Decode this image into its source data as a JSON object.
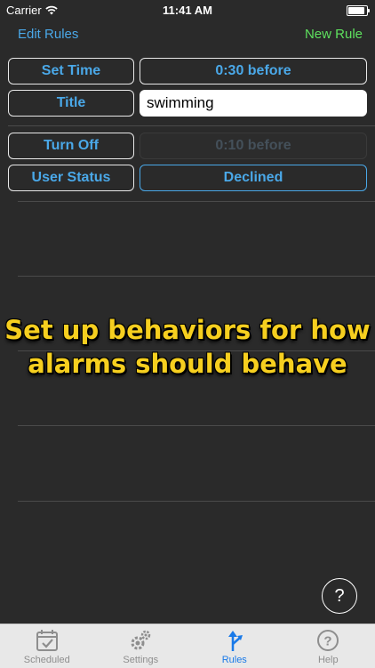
{
  "status_bar": {
    "carrier": "Carrier",
    "time": "11:41 AM"
  },
  "nav": {
    "left_label": "Edit Rules",
    "right_label": "New Rule"
  },
  "rules": {
    "set_time_label": "Set Time",
    "set_time_value": "0:30 before",
    "title_label": "Title",
    "title_value": "swimming",
    "turn_off_label": "Turn Off",
    "turn_off_value": "0:10 before",
    "user_status_label": "User Status",
    "user_status_value": "Declined"
  },
  "promo": {
    "line1": "Set up behaviors for how",
    "line2": "alarms should behave"
  },
  "help_button": {
    "label": "?"
  },
  "tabs": [
    {
      "label": "Scheduled",
      "icon": "calendar-check-icon",
      "active": false
    },
    {
      "label": "Settings",
      "icon": "gears-icon",
      "active": false
    },
    {
      "label": "Rules",
      "icon": "rules-arrow-icon",
      "active": true
    },
    {
      "label": "Help",
      "icon": "question-circle-icon",
      "active": false
    }
  ],
  "colors": {
    "background": "#2a2a2a",
    "accent_blue": "#4aa8e8",
    "new_rule_green": "#5ee05e",
    "promo_yellow": "#f6cf1f",
    "tab_active": "#1a7ae8"
  }
}
